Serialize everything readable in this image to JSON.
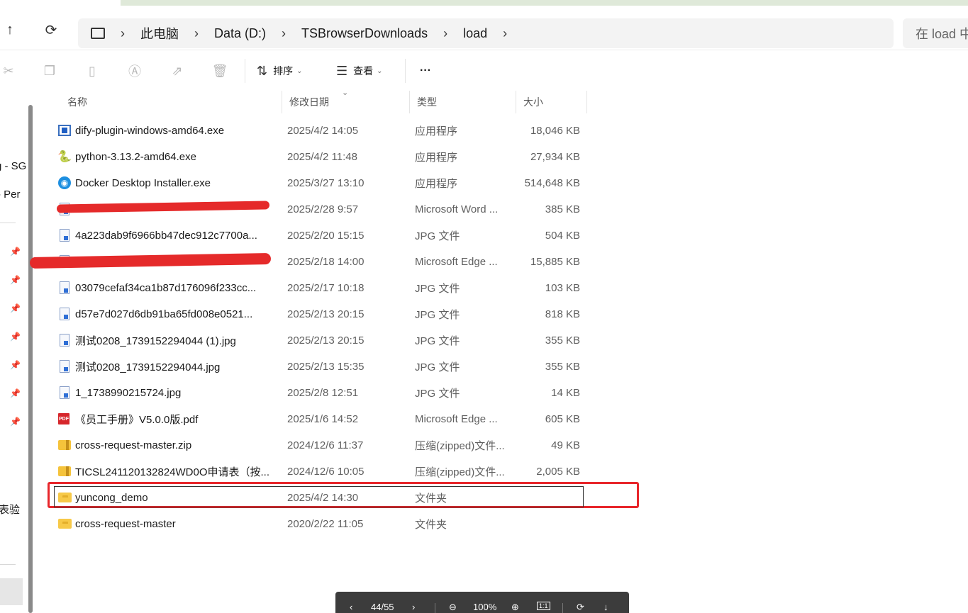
{
  "nav": {
    "up_glyph": "↑",
    "refresh_glyph": "⟳"
  },
  "breadcrumb": {
    "computer_icon": "computer-icon",
    "items": [
      "此电脑",
      "Data (D:)",
      "TSBrowserDownloads",
      "load"
    ]
  },
  "search": {
    "placeholder": "在 load 中"
  },
  "toolbar": {
    "sort_label": "排序",
    "view_label": "查看",
    "more_label": "···"
  },
  "sidebar": {
    "texts": [
      "g - SG",
      "- Per",
      "表验"
    ]
  },
  "columns": {
    "name": "名称",
    "date": "修改日期",
    "type": "类型",
    "size": "大小"
  },
  "files": [
    {
      "name": "dify-plugin-windows-amd64.exe",
      "date": "2025/4/2 14:05",
      "type": "应用程序",
      "size": "18,046 KB",
      "icon": "exe-icon"
    },
    {
      "name": "python-3.13.2-amd64.exe",
      "date": "2025/4/2 11:48",
      "type": "应用程序",
      "size": "27,934 KB",
      "icon": "python-installer-icon"
    },
    {
      "name": "Docker Desktop Installer.exe",
      "date": "2025/3/27 13:10",
      "type": "应用程序",
      "size": "514,648 KB",
      "icon": "docker-icon"
    },
    {
      "name": "",
      "date": "2025/2/28 9:57",
      "type": "Microsoft Word ...",
      "size": "385 KB",
      "icon": "word-doc-icon"
    },
    {
      "name": "4a223dab9f6966bb47dec912c7700a...",
      "date": "2025/2/20 15:15",
      "type": "JPG 文件",
      "size": "504 KB",
      "icon": "jpg-icon"
    },
    {
      "name": "",
      "date": "2025/2/18 14:00",
      "type": "Microsoft Edge ...",
      "size": "15,885 KB",
      "icon": "edge-doc-icon"
    },
    {
      "name": "03079cefaf34ca1b87d176096f233cc...",
      "date": "2025/2/17 10:18",
      "type": "JPG 文件",
      "size": "103 KB",
      "icon": "jpg-icon"
    },
    {
      "name": "d57e7d027d6db91ba65fd008e0521...",
      "date": "2025/2/13 20:15",
      "type": "JPG 文件",
      "size": "818 KB",
      "icon": "jpg-icon"
    },
    {
      "name": "测试0208_1739152294044 (1).jpg",
      "date": "2025/2/13 20:15",
      "type": "JPG 文件",
      "size": "355 KB",
      "icon": "jpg-icon"
    },
    {
      "name": "测试0208_1739152294044.jpg",
      "date": "2025/2/13 15:35",
      "type": "JPG 文件",
      "size": "355 KB",
      "icon": "jpg-icon"
    },
    {
      "name": "1_1738990215724.jpg",
      "date": "2025/2/8 12:51",
      "type": "JPG 文件",
      "size": "14 KB",
      "icon": "jpg-icon"
    },
    {
      "name": "《员工手册》V5.0.0版.pdf",
      "date": "2025/1/6 14:52",
      "type": "Microsoft Edge ...",
      "size": "605 KB",
      "icon": "pdf-icon"
    },
    {
      "name": "cross-request-master.zip",
      "date": "2024/12/6 11:37",
      "type": "压缩(zipped)文件...",
      "size": "49 KB",
      "icon": "zip-icon"
    },
    {
      "name": "TICSL241120132824WD0O申请表（按...",
      "date": "2024/12/6 10:05",
      "type": "压缩(zipped)文件...",
      "size": "2,005 KB",
      "icon": "zip-icon"
    },
    {
      "name": "yuncong_demo",
      "date": "2025/4/2 14:30",
      "type": "文件夹",
      "size": "",
      "icon": "folder-icon"
    },
    {
      "name": "cross-request-master",
      "date": "2020/2/22 11:05",
      "type": "文件夹",
      "size": "",
      "icon": "folder-icon"
    }
  ],
  "pager": {
    "page": "44/55",
    "zoom": "100%",
    "actual_size": "1:1"
  },
  "colors": {
    "highlight": "#e8262b",
    "redaction": "#e52a2a"
  }
}
